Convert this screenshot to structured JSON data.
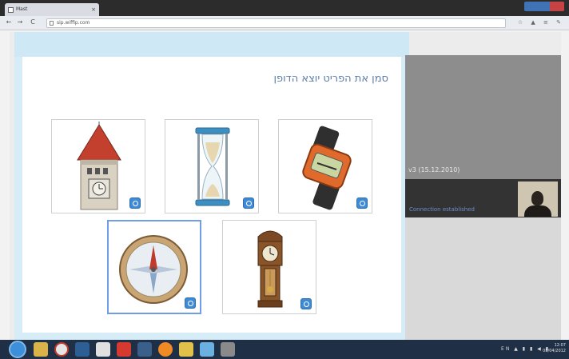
{
  "browser": {
    "tab_title": "Mast",
    "tab_close": "×",
    "address": "sip.wiffip.com",
    "back": "←",
    "forward": "→",
    "reload": "C",
    "toolbar_icons": "☆ ▲ ≡ ✎"
  },
  "quiz": {
    "question": "סמן את הפריט יוצא הדופן",
    "items": [
      {
        "name": "tower-clock",
        "selected": false
      },
      {
        "name": "hourglass",
        "selected": false
      },
      {
        "name": "wristwatch",
        "selected": false
      },
      {
        "name": "compass",
        "selected": true
      },
      {
        "name": "grandfather-clock",
        "selected": false
      }
    ]
  },
  "side_panel": {
    "version": "v3 (15.12.2010)",
    "connection_status": "Connection established"
  },
  "taskbar": {
    "tray": "EN ▲ ▮ ▮ ◀ ▮",
    "time": "12:07",
    "date": "08/04/2012"
  },
  "colors": {
    "accent": "#5d7ea8",
    "selected_border": "#6f9ee6",
    "zoom_button": "#3f8ad6"
  }
}
